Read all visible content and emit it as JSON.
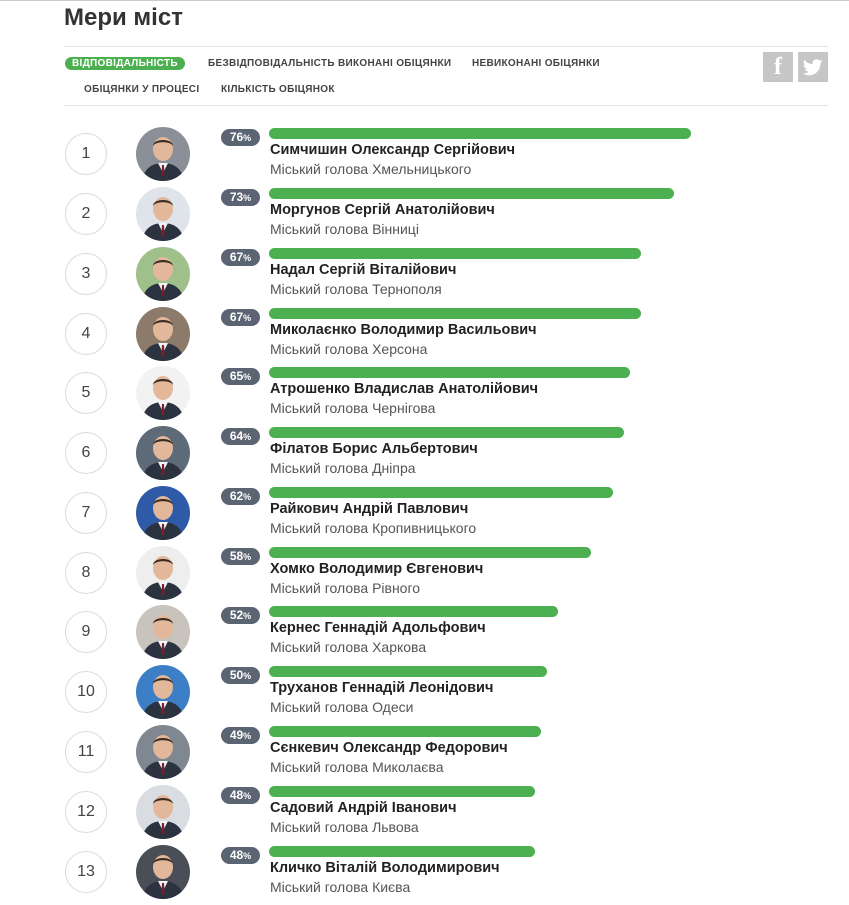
{
  "page": {
    "title": "Мери міст"
  },
  "tabs": [
    {
      "label": "ВІДПОВІДАЛЬНІСТЬ",
      "active": true
    },
    {
      "label": "БЕЗВІДПОВІДАЛЬНІСТЬ",
      "active": false
    },
    {
      "label": "ВИКОНАНІ ОБІЦЯНКИ",
      "active": false
    },
    {
      "label": "НЕВИКОНАНІ ОБІЦЯНКИ",
      "active": false
    },
    {
      "label": "ОБІЦЯНКИ У ПРОЦЕСІ",
      "active": false
    },
    {
      "label": "КІЛЬКІСТЬ ОБІЦЯНОК",
      "active": false
    }
  ],
  "social": {
    "facebook_icon": "facebook-icon",
    "twitter_icon": "twitter-icon"
  },
  "colors": {
    "bar": "#4caf50",
    "badge": "#5b6472",
    "accent": "#4caf50"
  },
  "mayors": [
    {
      "rank": "1",
      "percent": 76,
      "percent_text": "76",
      "name": "Симчишин Олександр Сергійович",
      "position": "Міський голова Хмельницького",
      "bg": "#8a8f98"
    },
    {
      "rank": "2",
      "percent": 73,
      "percent_text": "73",
      "name": "Моргунов Сергій Анатолійович",
      "position": "Міський голова Вінниці",
      "bg": "#dfe3ea"
    },
    {
      "rank": "3",
      "percent": 67,
      "percent_text": "67",
      "name": "Надал Сергій Віталійович",
      "position": "Міський голова Тернополя",
      "bg": "#9fc08a"
    },
    {
      "rank": "4",
      "percent": 67,
      "percent_text": "67",
      "name": "Миколаєнко Володимир Васильович",
      "position": "Міський голова Херсона",
      "bg": "#8c7a6a"
    },
    {
      "rank": "5",
      "percent": 65,
      "percent_text": "65",
      "name": "Атрошенко Владислав Анатолійович",
      "position": "Міський голова Чернігова",
      "bg": "#f2f2f2"
    },
    {
      "rank": "6",
      "percent": 64,
      "percent_text": "64",
      "name": "Філатов Борис Альбертович",
      "position": "Міський голова Дніпра",
      "bg": "#5d6a78"
    },
    {
      "rank": "7",
      "percent": 62,
      "percent_text": "62",
      "name": "Райкович Андрій Павлович",
      "position": "Міський голова Кропивницького",
      "bg": "#2f5aa8"
    },
    {
      "rank": "8",
      "percent": 58,
      "percent_text": "58",
      "name": "Хомко Володимир Євгенович",
      "position": "Міський голова Рівного",
      "bg": "#eeeeee"
    },
    {
      "rank": "9",
      "percent": 52,
      "percent_text": "52",
      "name": "Кернес Геннадій Адольфович",
      "position": "Міський голова Харкова",
      "bg": "#c8c3bc"
    },
    {
      "rank": "10",
      "percent": 50,
      "percent_text": "50",
      "name": "Труханов Геннадій Леонідович",
      "position": "Міський голова Одеси",
      "bg": "#3d7fc7"
    },
    {
      "rank": "11",
      "percent": 49,
      "percent_text": "49",
      "name": "Сєнкевич Олександр Федорович",
      "position": "Міський голова Миколаєва",
      "bg": "#7f8790"
    },
    {
      "rank": "12",
      "percent": 48,
      "percent_text": "48",
      "name": "Садовий Андрій Іванович",
      "position": "Міський голова Львова",
      "bg": "#d9dde2"
    },
    {
      "rank": "13",
      "percent": 48,
      "percent_text": "48",
      "name": "Кличко Віталій Володимирович",
      "position": "Міський голова Києва",
      "bg": "#4a4f57"
    }
  ],
  "percent_sign": "%"
}
